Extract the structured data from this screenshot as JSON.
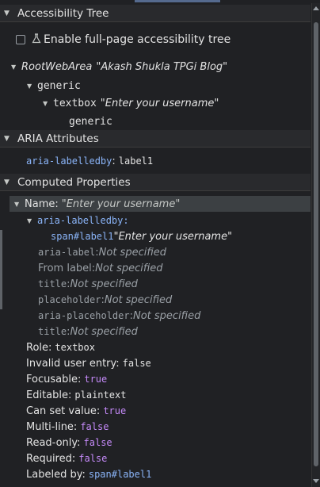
{
  "accessibility_tree": {
    "header": "Accessibility Tree",
    "checkbox_label": "Enable full-page accessibility tree",
    "nodes": [
      {
        "role": "RootWebArea",
        "name": "\"Akash Shukla TPGi Blog\""
      },
      {
        "role": "generic"
      },
      {
        "role": "textbox",
        "name": "\"Enter your username\""
      },
      {
        "role": "generic"
      }
    ]
  },
  "aria_attributes": {
    "header": "ARIA Attributes",
    "attr": "aria-labelledby",
    "colon": ":",
    "value": "label1"
  },
  "computed_properties": {
    "header": "Computed Properties",
    "name_label": "Name:",
    "name_value": "\"Enter your username\"",
    "labelledby_key": "aria-labelledby:",
    "labelledby_source": "span#label1",
    "labelledby_value": "\"Enter your username\"",
    "sources": [
      {
        "key": "aria-label",
        "key_mono": true,
        "value": "Not specified"
      },
      {
        "key": "From label",
        "key_mono": false,
        "value": "Not specified"
      },
      {
        "key": "title",
        "key_mono": true,
        "value": "Not specified"
      },
      {
        "key": "placeholder",
        "key_mono": true,
        "value": "Not specified"
      },
      {
        "key": "aria-placeholder",
        "key_mono": true,
        "value": "Not specified"
      },
      {
        "key": "title",
        "key_mono": true,
        "value": "Not specified"
      }
    ],
    "properties": [
      {
        "label": "Role:",
        "value": "textbox",
        "kind": "plain"
      },
      {
        "label": "Invalid user entry:",
        "value": "false",
        "kind": "plain"
      },
      {
        "label": "Focusable:",
        "value": "true",
        "kind": "bool"
      },
      {
        "label": "Editable:",
        "value": "plaintext",
        "kind": "plain"
      },
      {
        "label": "Can set value:",
        "value": "true",
        "kind": "bool"
      },
      {
        "label": "Multi-line:",
        "value": "false",
        "kind": "bool"
      },
      {
        "label": "Read-only:",
        "value": "false",
        "kind": "bool"
      },
      {
        "label": "Required:",
        "value": "false",
        "kind": "bool"
      },
      {
        "label": "Labeled by:",
        "value": "span#label1",
        "kind": "link"
      }
    ]
  },
  "colors": {
    "background": "#202124",
    "header_bg": "#292a2d",
    "attr_key": "#8ab4f8",
    "bool_value": "#c58af9",
    "dim_text": "#9aa0a6"
  }
}
